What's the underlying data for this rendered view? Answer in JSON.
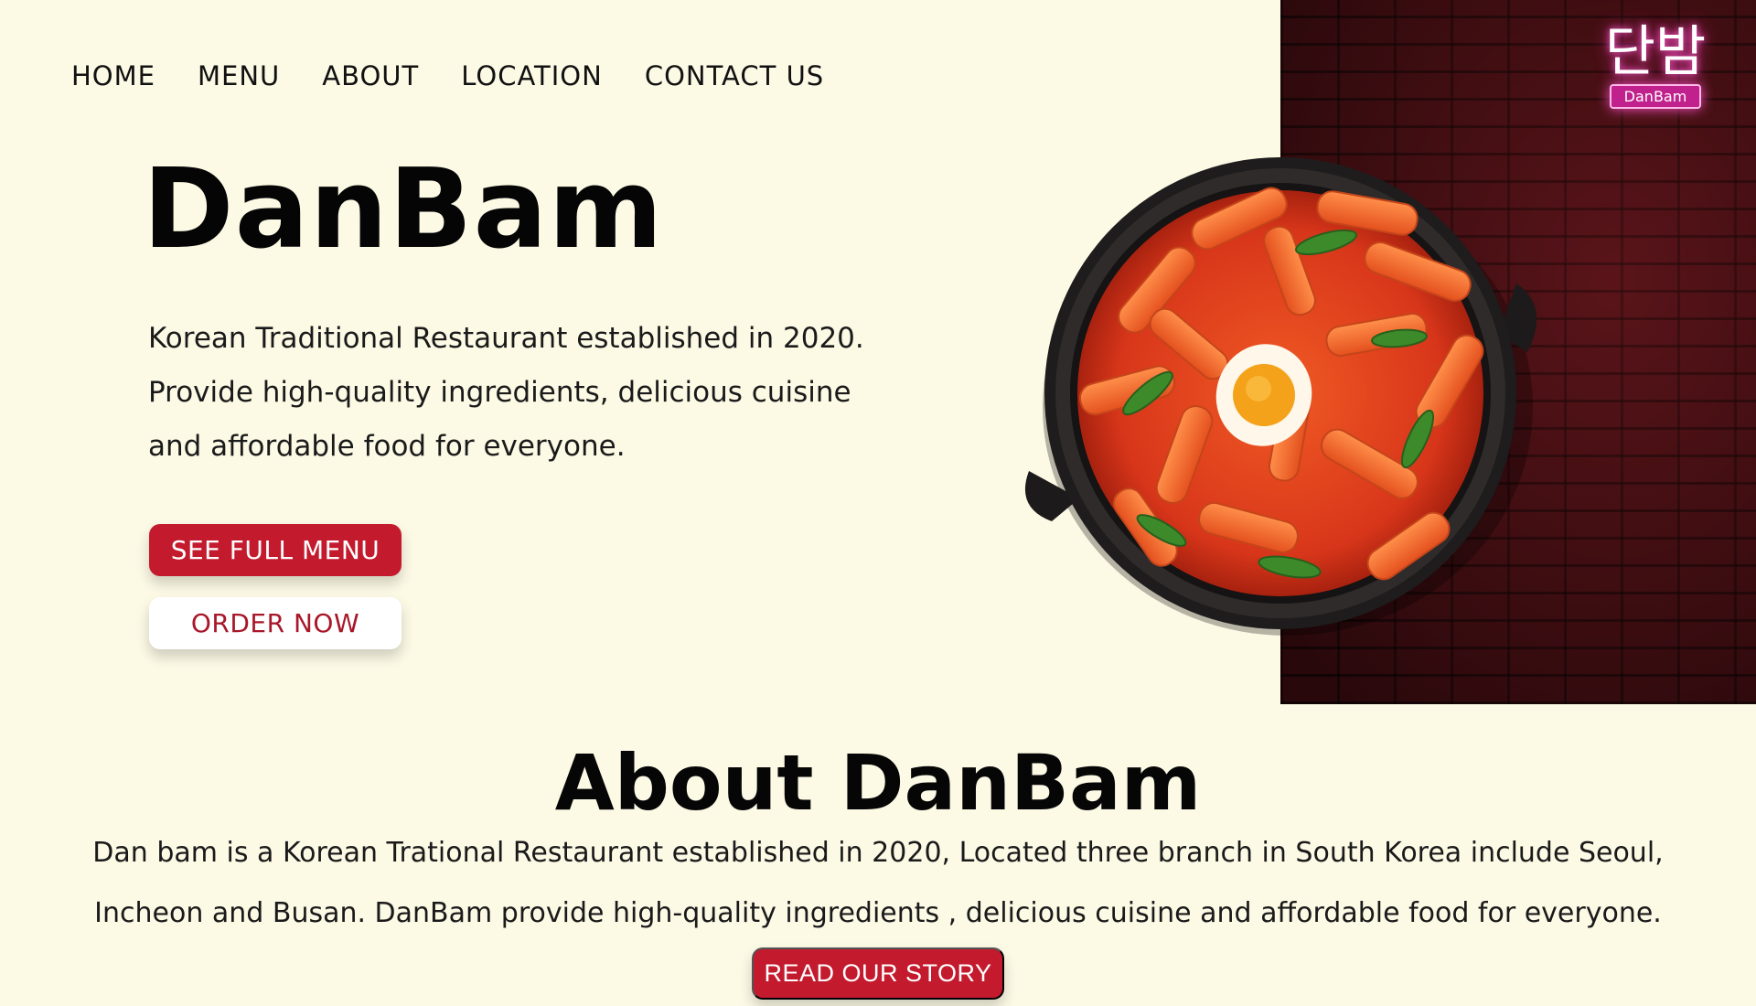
{
  "nav": {
    "items": [
      {
        "label": "HOME"
      },
      {
        "label": "MENU"
      },
      {
        "label": "ABOUT"
      },
      {
        "label": "LOCATION"
      },
      {
        "label": "CONTACT US"
      }
    ]
  },
  "logo": {
    "korean": "단밤",
    "english": "DanBam"
  },
  "hero": {
    "title": "DanBam",
    "description_lines": [
      "Korean Traditional Restaurant established in 2020.",
      "Provide high-quality ingredients, delicious cuisine",
      "and affordable food for everyone."
    ],
    "see_menu_label": "SEE FULL MENU",
    "order_label": "ORDER NOW"
  },
  "about": {
    "title": "About DanBam",
    "text_lines": [
      "Dan bam is a Korean Trational Restaurant established in 2020,  Located three branch in South Korea include Seoul,",
      "Incheon and Busan. DanBam provide high-quality ingredients , delicious cuisine and affordable food for everyone."
    ],
    "story_label": "READ OUR STORY"
  },
  "colors": {
    "background": "#fcf9e5",
    "accent_red": "#c41a2e",
    "brick": "#4a0f14",
    "neon_pink": "#e0309e"
  }
}
